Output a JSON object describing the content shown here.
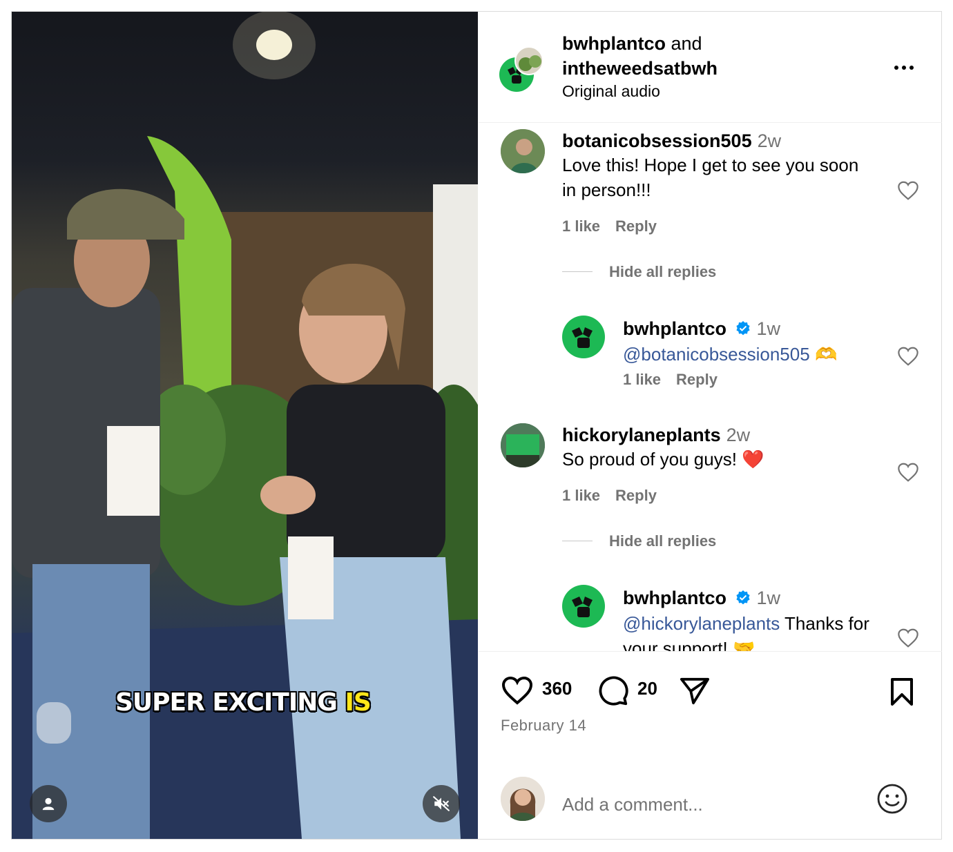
{
  "media": {
    "caption_white": "SUPER EXCITING",
    "caption_highlight": "IS",
    "highlight_color": "#ffe619"
  },
  "header": {
    "user1": "bwhplantco",
    "joiner": "and",
    "user2": "intheweedsatbwh",
    "subtitle": "Original audio"
  },
  "comments": [
    {
      "username": "botanicobsession505",
      "time": "2w",
      "text": "Love this! Hope I get to see you soon in person!!!",
      "likes": "1 like",
      "reply": "Reply",
      "hide_replies": "Hide all replies",
      "replies": [
        {
          "username": "bwhplantco",
          "verified": true,
          "time": "1w",
          "mention": "@botanicobsession505",
          "text": "🫶",
          "likes": "1 like",
          "reply": "Reply"
        }
      ]
    },
    {
      "username": "hickorylaneplants",
      "time": "2w",
      "text": "So proud of you guys! ❤️",
      "likes": "1 like",
      "reply": "Reply",
      "hide_replies": "Hide all replies",
      "replies": [
        {
          "username": "bwhplantco",
          "verified": true,
          "time": "1w",
          "mention": "@hickorylaneplants",
          "text": " Thanks for your support! 🤝"
        }
      ]
    }
  ],
  "actions": {
    "like_count": "360",
    "comment_count": "20",
    "date": "February 14"
  },
  "composer": {
    "placeholder": "Add a comment..."
  },
  "colors": {
    "brand_green": "#1db954",
    "link_blue": "#385898",
    "verified_blue": "#0095f6",
    "muted_text": "#737373"
  }
}
